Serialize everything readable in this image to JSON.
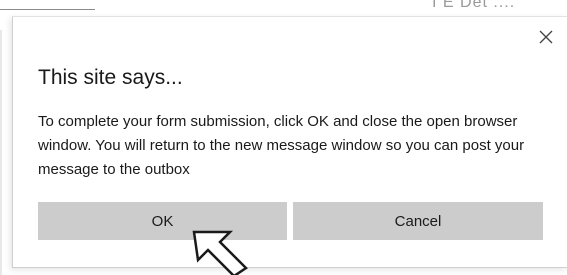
{
  "dialog": {
    "title": "This site says...",
    "message": "To complete your form submission, click OK and close the open browser window. You will return to the new message window so you can post your message to the outbox",
    "close_icon": "close-icon",
    "ok_label": "OK",
    "cancel_label": "Cancel"
  },
  "background": {
    "fragment_text": "I E Det ...."
  },
  "cursor": {
    "icon": "arrow-cursor-icon"
  },
  "colors": {
    "button_bg": "#cccccc",
    "text": "#1a1a1a",
    "dialog_bg": "#ffffff"
  }
}
